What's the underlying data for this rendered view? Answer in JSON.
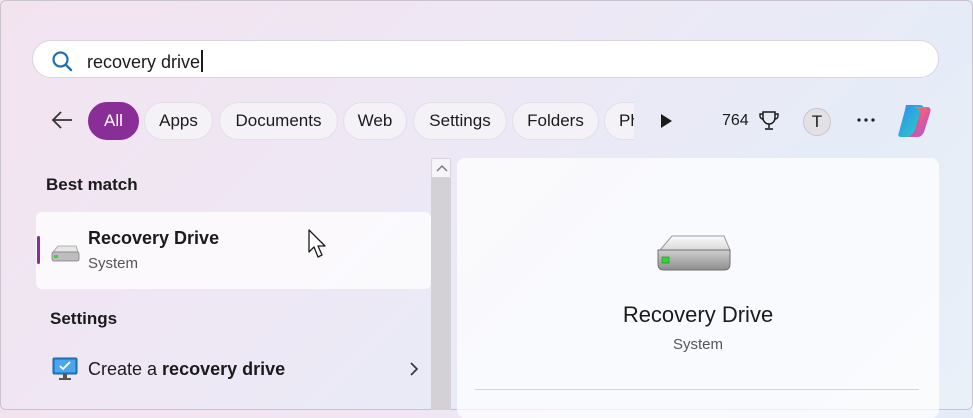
{
  "search": {
    "value": "recovery drive"
  },
  "filters": {
    "chips": [
      "All",
      "Apps",
      "Documents",
      "Web",
      "Settings",
      "Folders",
      "Ph"
    ],
    "active": "All",
    "points": "764",
    "avatar_initial": "T"
  },
  "left": {
    "best_match_title": "Best match",
    "best_match": {
      "name": "Recovery Drive",
      "type": "System"
    },
    "settings_title": "Settings",
    "settings_item": {
      "prefix": "Create a ",
      "bold": "recovery drive"
    }
  },
  "right": {
    "name": "Recovery Drive",
    "type": "System"
  },
  "icons": {
    "search": "search-icon",
    "back": "back-arrow-icon",
    "play": "play-icon",
    "trophy": "trophy-icon",
    "more": "more-icon",
    "copilot": "copilot-icon",
    "drive": "drive-icon",
    "monitor": "monitor-icon",
    "chevron": "chevron-right-icon"
  },
  "colors": {
    "accent": "#8a2e97"
  }
}
